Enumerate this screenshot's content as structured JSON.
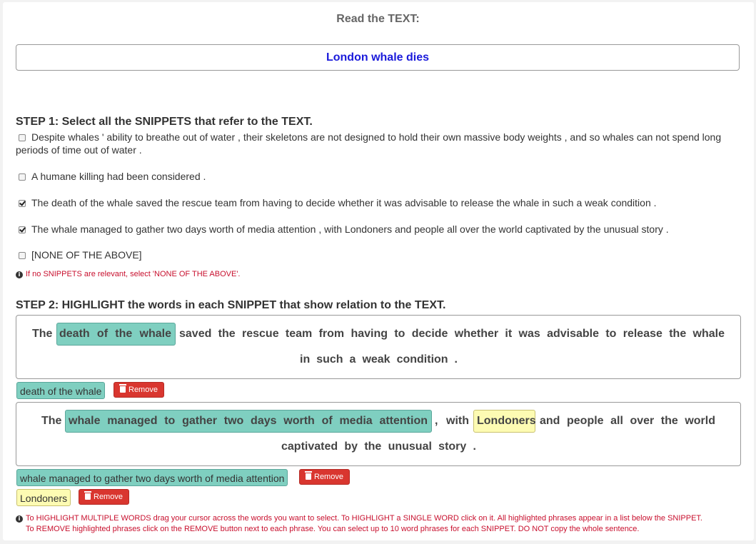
{
  "header": {
    "title": "Read the TEXT:"
  },
  "text": {
    "value": "London whale dies"
  },
  "step1": {
    "title": "STEP 1: Select all the SNIPPETS that refer to the TEXT.",
    "options": [
      {
        "line1": "Despite whales ' ability to breathe out of water , their skeletons are not designed to hold their own massive body weights , and so whales can not spend long",
        "line2": "periods of time out of water .",
        "checked": false
      },
      {
        "line1": "A humane killing had been considered .",
        "checked": false
      },
      {
        "line1": "The death of the whale saved the rescue team from having to decide whether it was advisable to release the whale in such a weak condition .",
        "checked": true
      },
      {
        "line1": "The whale managed to gather two days worth of media attention , with Londoners and people all over the world captivated by the unusual story .",
        "checked": true
      },
      {
        "line1": "[NONE OF THE ABOVE]",
        "checked": false
      }
    ],
    "hint": "If no SNIPPETS are relevant, select 'NONE OF THE ABOVE'."
  },
  "step2": {
    "title": "STEP 2: HIGHLIGHT the words in each SNIPPET that show relation to the TEXT.",
    "snippet1": {
      "w_the": "The",
      "hl_death": "death of the whale",
      "rest1": "saved the rescue team from having to decide whether it was advisable to release the whale",
      "rest2": "in such a weak condition .",
      "tags": [
        {
          "label": "death of the whale",
          "remove": "Remove"
        }
      ]
    },
    "snippet2": {
      "w_the": "The",
      "hl_whale": "whale managed to gather two days worth of media attention",
      "w_comma": ", with",
      "hl_london": "Londoners",
      "rest1": "and people all over the world",
      "rest2": "captivated by the unusual story .",
      "tags": [
        {
          "label": "whale managed to gather two days worth of media attention",
          "remove": "Remove"
        },
        {
          "label": "Londoners",
          "remove": "Remove"
        }
      ]
    },
    "instructions_line1": "To HIGHLIGHT MULTIPLE WORDS drag your cursor across the words you want to select. To HIGHLIGHT a SINGLE WORD click on it. All highlighted phrases appear in a list below the SNIPPET.",
    "instructions_line2": "To REMOVE highlighted phrases click on the REMOVE button next to each phrase. You can select up to 10 word phrases for each SNIPPET. DO NOT copy the whole sentence."
  },
  "colors": {
    "highlight_green": "#7fcfc0",
    "highlight_yellow": "#fdfbb3",
    "remove_red": "#d9362f",
    "hint_red": "#c8102e",
    "text_blue": "#1a1adb"
  }
}
